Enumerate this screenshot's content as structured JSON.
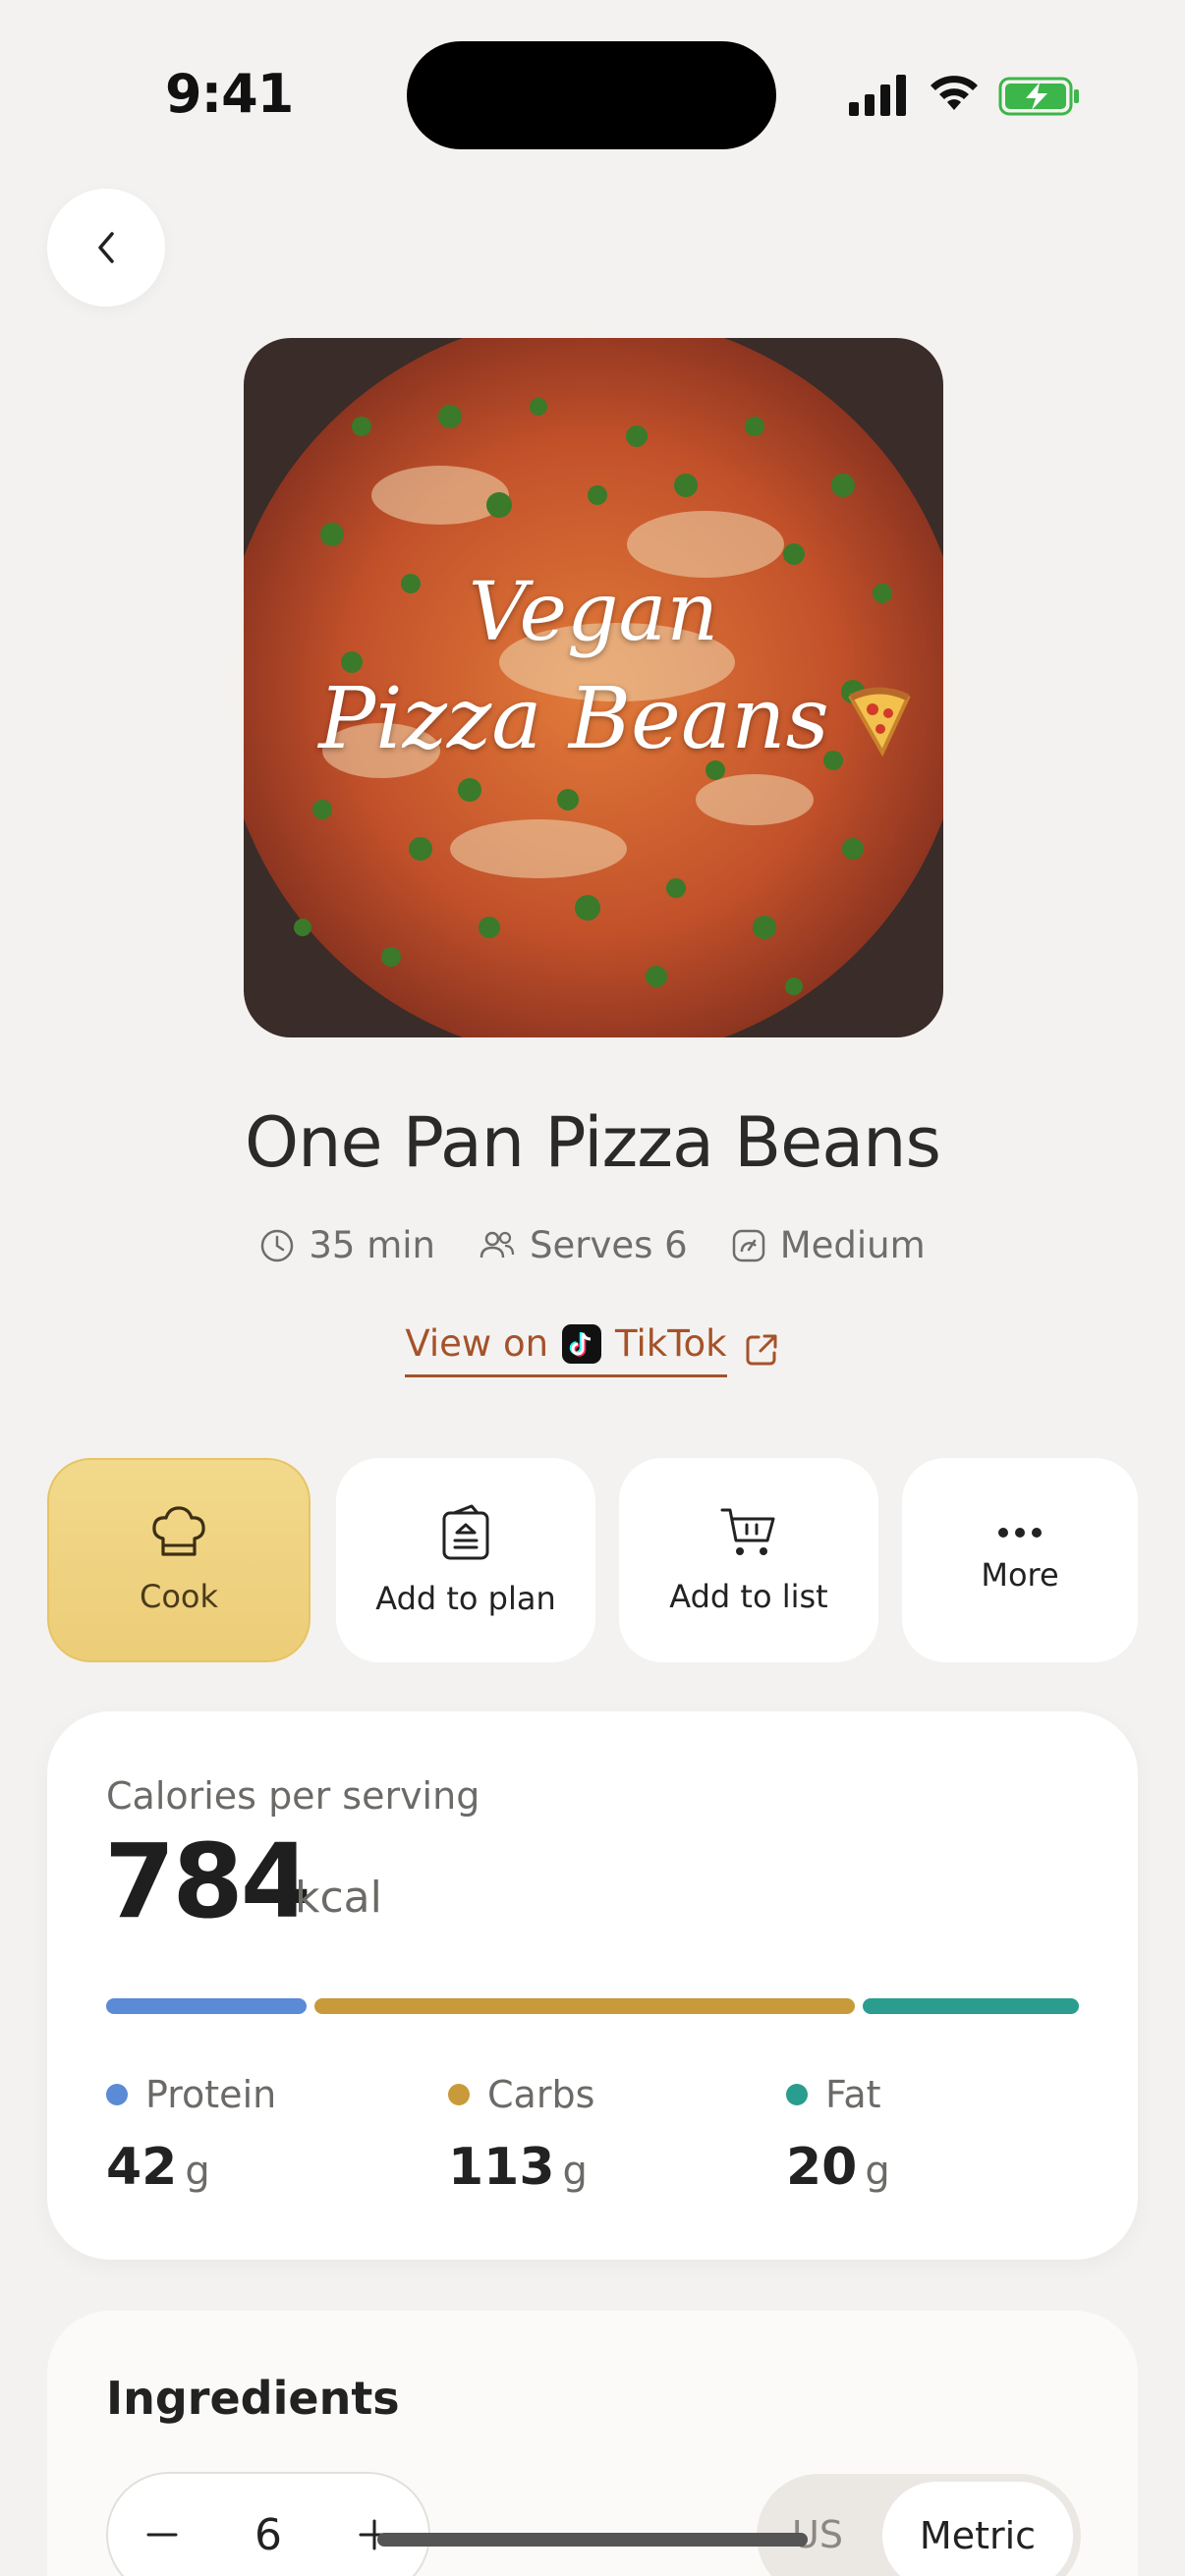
{
  "status": {
    "time": "9:41"
  },
  "recipe": {
    "image_caption_line1": "Vegan",
    "image_caption_line2": "Pizza Beans",
    "title": "One Pan Pizza Beans",
    "time": "35 min",
    "serves": "Serves 6",
    "difficulty": "Medium",
    "source_prefix": "View on",
    "source_name": "TikTok"
  },
  "actions": [
    {
      "label": "Cook",
      "icon": "chef-hat-icon"
    },
    {
      "label": "Add to plan",
      "icon": "plan-clipboard-icon"
    },
    {
      "label": "Add to list",
      "icon": "shopping-cart-icon"
    },
    {
      "label": "More",
      "icon": "more-dots-icon"
    }
  ],
  "nutrition": {
    "calories_label": "Calories per serving",
    "calories": "784",
    "calories_unit": "kcal",
    "macros": [
      {
        "name": "Protein",
        "value": "42",
        "unit": "g",
        "color": "#5b8ad6"
      },
      {
        "name": "Carbs",
        "value": "113",
        "unit": "g",
        "color": "#c99a3a"
      },
      {
        "name": "Fat",
        "value": "20",
        "unit": "g",
        "color": "#2a9d8f"
      }
    ]
  },
  "ingredients": {
    "title": "Ingredients",
    "servings": "6",
    "unit_options": [
      "US",
      "Metric"
    ],
    "selected_unit": "Metric"
  },
  "colors": {
    "accent_tiktok": "#a5522a",
    "cook_button": "#eccd78",
    "background": "#f4f2f0"
  }
}
